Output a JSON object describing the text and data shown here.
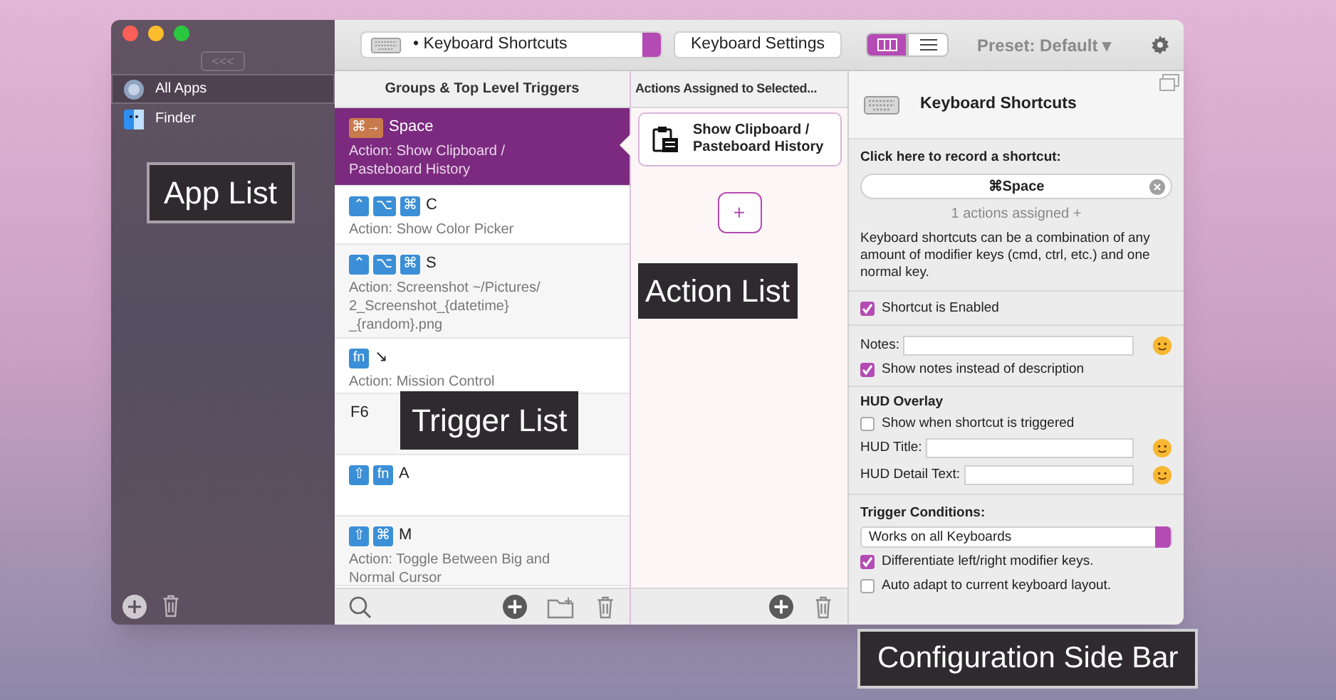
{
  "sidebar": {
    "collapse_button": "<<<",
    "items": [
      {
        "label": "All Apps",
        "selected": true
      },
      {
        "label": "Finder",
        "selected": false
      }
    ]
  },
  "toolbar": {
    "trigger_type": "• Keyboard Shortcuts",
    "settings_button": "Keyboard Settings",
    "views": [
      {
        "selected": true
      },
      {
        "selected": false
      }
    ],
    "preset": "Preset: Default ▾"
  },
  "trigger_list": {
    "header": "Groups & Top Level Triggers",
    "rows": [
      {
        "selected": true,
        "keys": [
          "⌘→"
        ],
        "key": "Space",
        "action": "Action: Show Clipboard / Pasteboard History"
      },
      {
        "selected": false,
        "keys": [
          "⌃",
          "⌥",
          "⌘"
        ],
        "key": "C",
        "action": "Action: Show Color Picker"
      },
      {
        "selected": false,
        "keys": [
          "⌃",
          "⌥",
          "⌘"
        ],
        "key": "S",
        "action": "Action: Screenshot ~/Pictures/ 2_Screenshot_{datetime} _{random}.png"
      },
      {
        "selected": false,
        "keys": [
          "fn"
        ],
        "key": "↘",
        "action": "Action: Mission Control"
      },
      {
        "selected": false,
        "keys": [],
        "key": "F6",
        "action": ""
      },
      {
        "selected": false,
        "keys": [
          "⇧",
          "fn"
        ],
        "key": "A",
        "action": ""
      },
      {
        "selected": false,
        "keys": [
          "⇧",
          "⌘"
        ],
        "key": "M",
        "action": "Action: Toggle Between Big and Normal Cursor"
      }
    ]
  },
  "action_list": {
    "header": "Actions Assigned to Selected...",
    "actions": [
      {
        "label": "Show Clipboard / Pasteboard History"
      }
    ],
    "add_button": "+"
  },
  "config": {
    "title": "Keyboard Shortcuts",
    "record_label": "Click here to record a shortcut:",
    "shortcut": "⌘Space",
    "assigned": "1 actions assigned +",
    "help": "Keyboard shortcuts can be a combination of any amount of modifier keys (cmd, ctrl, etc.) and one normal key.",
    "enabled": {
      "label": "Shortcut is Enabled",
      "checked": true
    },
    "notes_label": "Notes:",
    "show_notes": {
      "label": "Show notes instead of description",
      "checked": true
    },
    "hud_heading": "HUD Overlay",
    "hud_show": {
      "label": "Show when shortcut is triggered",
      "checked": false
    },
    "hud_title_label": "HUD Title:",
    "hud_detail_label": "HUD Detail Text:",
    "conditions_heading": "Trigger Conditions:",
    "keyboard_select": "Works on all Keyboards",
    "differentiate": {
      "label": "Differentiate left/right modifier keys.",
      "checked": true
    },
    "auto_adapt": {
      "label": "Auto adapt to current keyboard layout.",
      "checked": false
    }
  },
  "callouts": [
    {
      "label": "App List"
    },
    {
      "label": "Action List"
    },
    {
      "label": "Trigger List"
    },
    {
      "label": "Configuration Side Bar"
    }
  ]
}
